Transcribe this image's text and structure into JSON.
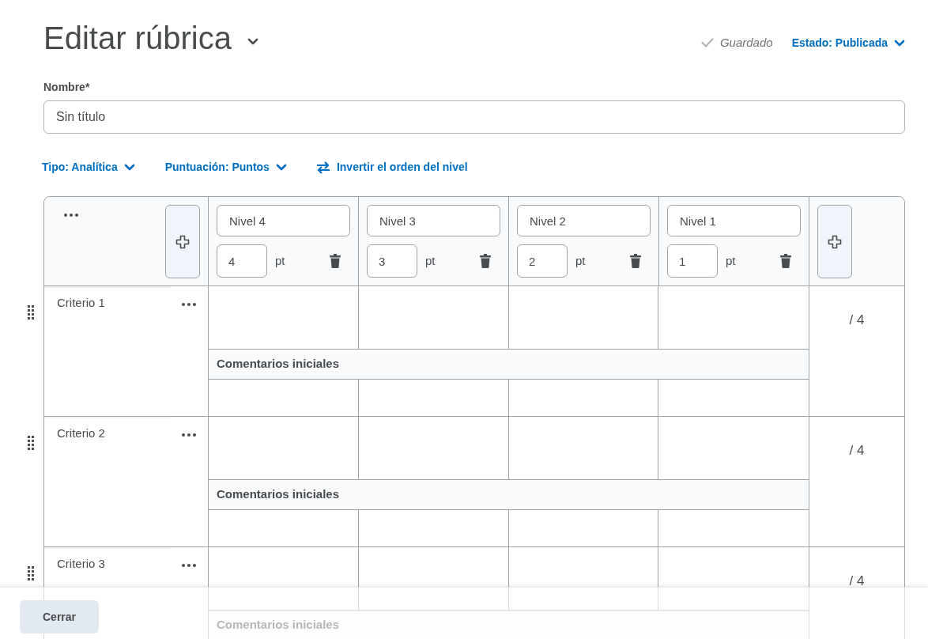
{
  "title": "Editar rúbrica",
  "saved_label": "Guardado",
  "status_menu": "Estado: Publicada",
  "name_field": {
    "label": "Nombre*",
    "value": "Sin título"
  },
  "toolbar": {
    "type_menu": "Tipo: Analítica",
    "scoring_menu": "Puntuación: Puntos",
    "reverse_link": "Invertir el orden del nivel"
  },
  "levels": [
    {
      "name": "Nivel 4",
      "points": "4",
      "unit": "pt"
    },
    {
      "name": "Nivel 3",
      "points": "3",
      "unit": "pt"
    },
    {
      "name": "Nivel 2",
      "points": "2",
      "unit": "pt"
    },
    {
      "name": "Nivel 1",
      "points": "1",
      "unit": "pt"
    }
  ],
  "criteria": [
    {
      "name": "Criterio 1",
      "total": "/ 4",
      "comments_label": "Comentarios iniciales"
    },
    {
      "name": "Criterio 2",
      "total": "/ 4",
      "comments_label": "Comentarios iniciales"
    },
    {
      "name": "Criterio 3",
      "total": "/ 4",
      "comments_label": "Comentarios iniciales"
    }
  ],
  "footer": {
    "close_button": "Cerrar"
  }
}
